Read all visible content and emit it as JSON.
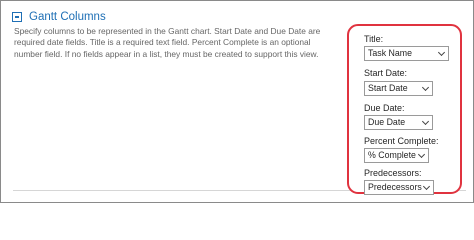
{
  "section": {
    "title": "Gantt Columns",
    "description": "Specify columns to be represented in the Gantt chart. Start Date and Due Date are required date fields. Title is a required text field. Percent Complete is an optional number field. If no fields appear in a list, they must be created to support this view."
  },
  "fields": [
    {
      "label": "Title:",
      "value": "Task Name"
    },
    {
      "label": "Start Date:",
      "value": "Start Date"
    },
    {
      "label": "Due Date:",
      "value": "Due Date"
    },
    {
      "label": "Percent Complete:",
      "value": "% Complete"
    },
    {
      "label": "Predecessors:",
      "value": "Predecessors"
    }
  ],
  "colors": {
    "section_title": "#1e6fb5",
    "highlight_border": "#e0333f",
    "description_text": "#666666"
  },
  "icons": {
    "collapse": "collapse-minus-icon",
    "dropdown": "chevron-down-icon"
  }
}
